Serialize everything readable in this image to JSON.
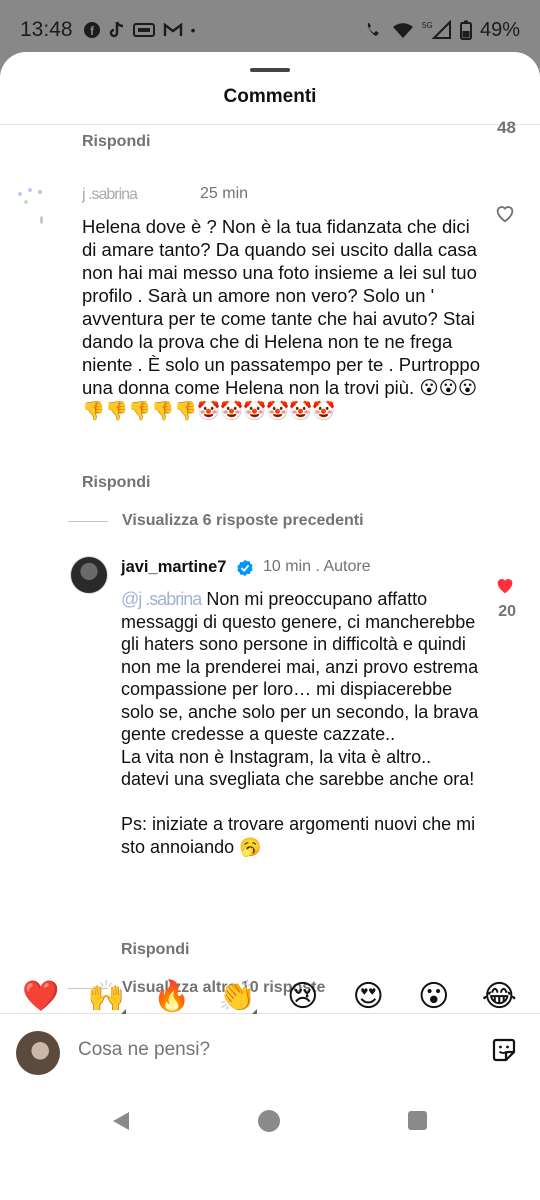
{
  "status_bar": {
    "time": "13:48",
    "icons_left": [
      "facebook-icon",
      "tiktok-icon",
      "video-icon",
      "gmail-icon",
      "dot"
    ],
    "network": "5G",
    "battery": "49%"
  },
  "sheet": {
    "title": "Commenti"
  },
  "previous": {
    "reply_label": "Rispondi",
    "like_count": "48"
  },
  "comment1": {
    "username": "j    .sabrina",
    "time": "25 min",
    "text": "Helena dove è ? Non è la tua fidanzata che dici di amare tanto? Da quando sei uscito dalla casa non hai mai messo una foto insieme a lei sul tuo profilo . Sarà un amore non vero? Solo un ' avventura per te come tante che hai avuto? Stai dando la prova che di Helena non te ne frega niente . È solo un passatempo per te . Purtroppo una donna come Helena non la trovi più. 😮😮😮👎👎👎👎👎🤡🤡🤡🤡🤡🤡",
    "reply_label": "Rispondi"
  },
  "view_previous": "Visualizza 6 risposte precedenti",
  "reply1": {
    "username": "javi_martine7",
    "time": "10 min",
    "author_tag": "Autore",
    "mention": "@j      .sabrina",
    "text": "Non mi preoccupano affatto messaggi di questo genere, ci mancherebbe gli haters sono persone in difficoltà e quindi non me la prenderei mai, anzi provo estrema compassione per loro… mi dispiacerebbe solo se, anche solo per un secondo, la brava gente credesse a queste cazzate..",
    "text2": "La vita non è Instagram, la vita è altro.. datevi una svegliata che sarebbe anche ora!",
    "text3": "Ps: iniziate a trovare argomenti nuovi che mi sto annoiando 🥱",
    "likes": "20",
    "reply_label": "Rispondi"
  },
  "view_more": "Visualizza altre 10 risposte",
  "emoji_bar": [
    "❤️",
    "🙌",
    "🔥",
    "👏",
    "😢",
    "😍",
    "😮",
    "😂"
  ],
  "composer": {
    "placeholder": "Cosa ne pensi?"
  },
  "colors": {
    "accent_red": "#ff3040",
    "verified_blue": "#0095f6",
    "muted": "#737373"
  }
}
